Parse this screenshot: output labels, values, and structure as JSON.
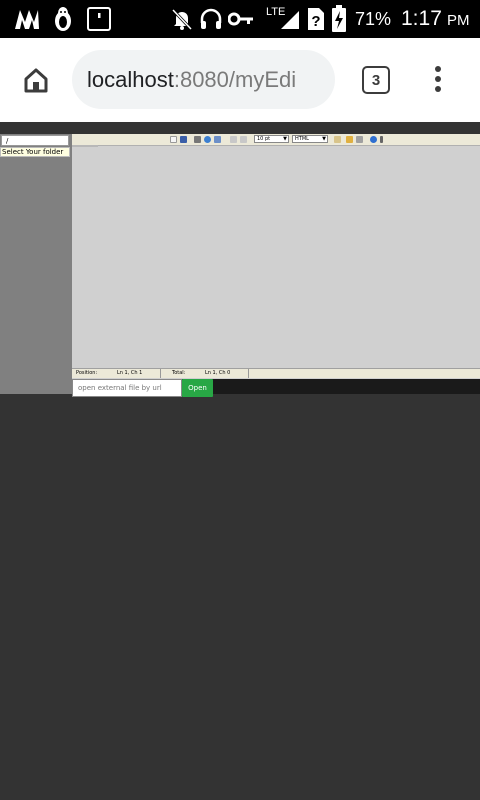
{
  "status_bar": {
    "network": "LTE",
    "battery_percent": "71%",
    "time": "1:17",
    "ampm": "PM",
    "icons": [
      "maps-icon",
      "penguin-icon",
      "screen-icon",
      "muted-bell-icon",
      "headset-icon",
      "key-icon",
      "signal-icon",
      "sim-unknown-icon",
      "battery-charging-icon"
    ]
  },
  "browser": {
    "url_host": "localhost",
    "url_rest": ":8080/myEdi",
    "tab_count": "3",
    "icons": [
      "home-icon",
      "more-vert-icon"
    ]
  },
  "sidebar": {
    "path_value": "/",
    "folder_tooltip": "Select Your folder"
  },
  "editor": {
    "font_size_option": "10 pt",
    "syntax_option": "HTML",
    "status": {
      "position_label": "Position:",
      "position_value": "Ln 1, Ch 1",
      "total_label": "Total:",
      "total_value": "Ln 1, Ch 0"
    }
  },
  "footer": {
    "url_placeholder": "open external file by url",
    "open_label": "Open"
  },
  "colors": {
    "status_bar_bg": "#000000",
    "page_bg": "#333333",
    "sidebar_bg": "#808080",
    "editor_bg": "#d0d0d0",
    "open_button": "#28a745"
  }
}
